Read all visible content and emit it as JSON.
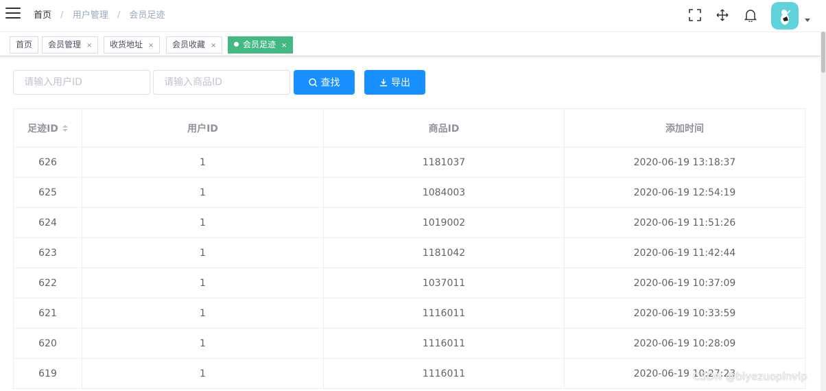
{
  "breadcrumb": {
    "home": "首页",
    "section": "用户管理",
    "current": "会员足迹",
    "separator": "/"
  },
  "right_menu": {
    "icons": [
      "fullscreen-icon",
      "size-move-icon",
      "bell-icon"
    ]
  },
  "tags": [
    {
      "label": "首页",
      "closable": false,
      "active": false
    },
    {
      "label": "会员管理",
      "closable": true,
      "active": false
    },
    {
      "label": "收货地址",
      "closable": true,
      "active": false
    },
    {
      "label": "会员收藏",
      "closable": true,
      "active": false
    },
    {
      "label": "会员足迹",
      "closable": true,
      "active": true
    }
  ],
  "tag_close_glyph": "×",
  "filter": {
    "user_id_placeholder": "请输入用户ID",
    "goods_id_placeholder": "请输入商品ID",
    "search_label": "查找",
    "export_label": "导出"
  },
  "table": {
    "columns": [
      "足迹ID",
      "用户ID",
      "商品ID",
      "添加时间"
    ],
    "rows": [
      [
        "626",
        "1",
        "1181037",
        "2020-06-19 13:18:37"
      ],
      [
        "625",
        "1",
        "1084003",
        "2020-06-19 12:54:19"
      ],
      [
        "624",
        "1",
        "1019002",
        "2020-06-19 11:51:26"
      ],
      [
        "623",
        "1",
        "1181042",
        "2020-06-19 11:42:44"
      ],
      [
        "622",
        "1",
        "1037011",
        "2020-06-19 10:37:09"
      ],
      [
        "621",
        "1",
        "1116011",
        "2020-06-19 10:33:59"
      ],
      [
        "620",
        "1",
        "1116011",
        "2020-06-19 10:28:09"
      ],
      [
        "619",
        "1",
        "1116011",
        "2020-06-19 10:27:23"
      ]
    ]
  },
  "watermark": "CSDN @biyezuopinvip",
  "colors": {
    "primary": "#1890ff",
    "active_tag": "#42b983",
    "avatar_bg": "#5fd3d9"
  }
}
